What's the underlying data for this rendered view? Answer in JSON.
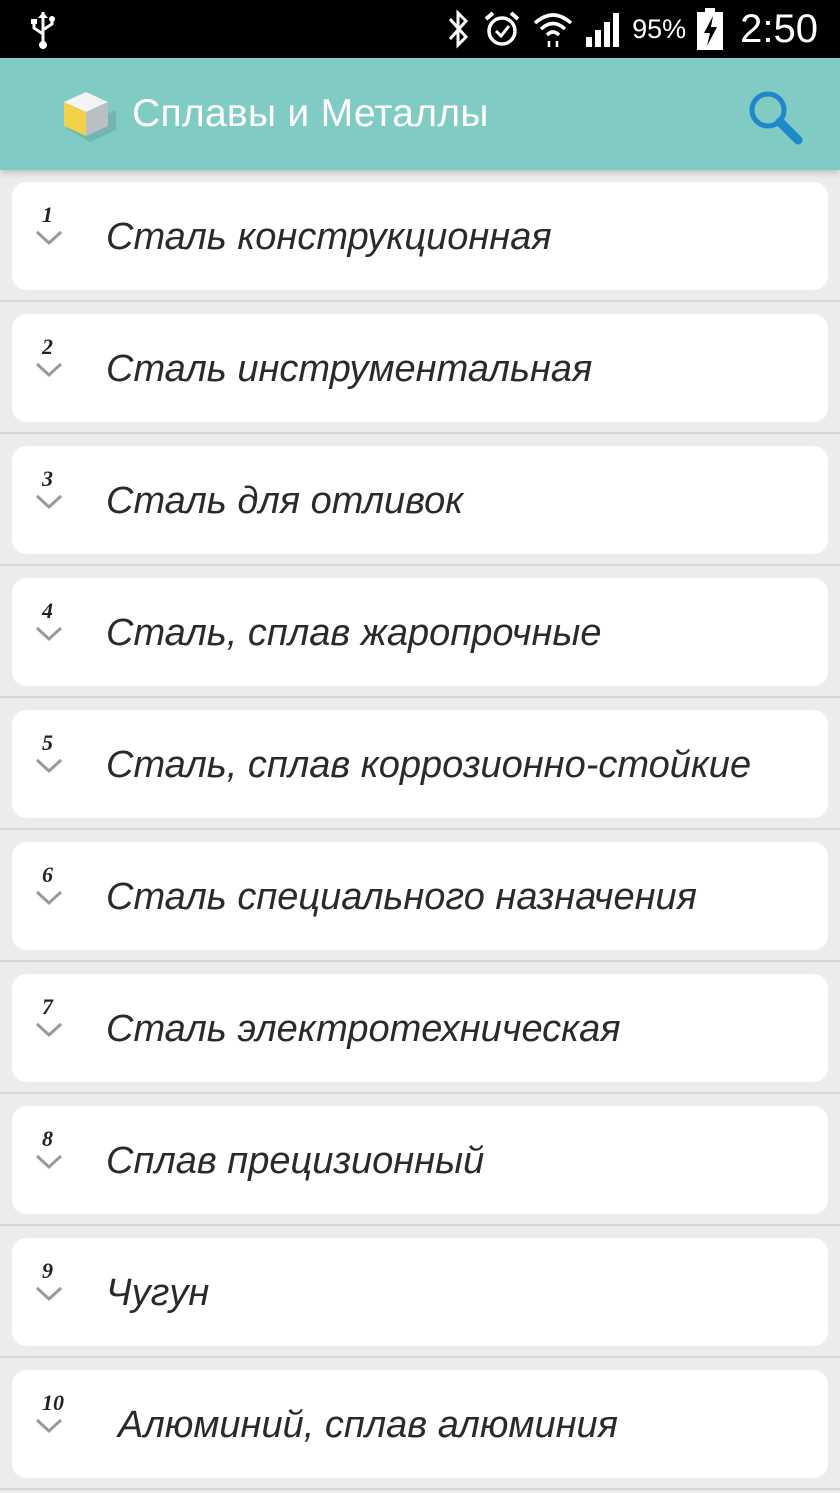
{
  "status_bar": {
    "battery_percent": "95%",
    "time": "2:50",
    "icons": [
      "usb-icon",
      "bluetooth-icon",
      "alarm-icon",
      "wifi-icon",
      "signal-icon",
      "battery-charging-icon"
    ]
  },
  "app_bar": {
    "title": "Сплавы и Металлы",
    "icon": "cube-app-icon",
    "search_icon": "search-icon",
    "background_color": "#80cbc4"
  },
  "list": {
    "items": [
      {
        "number": "1",
        "label": "Сталь конструкционная"
      },
      {
        "number": "2",
        "label": "Сталь инструментальная"
      },
      {
        "number": "3",
        "label": "Сталь для отливок"
      },
      {
        "number": "4",
        "label": "Сталь, сплав жаропрочные"
      },
      {
        "number": "5",
        "label": "Сталь, сплав коррозионно-стойкие"
      },
      {
        "number": "6",
        "label": "Сталь специального назначения"
      },
      {
        "number": "7",
        "label": "Сталь электротехническая"
      },
      {
        "number": "8",
        "label": "Сплав прецизионный"
      },
      {
        "number": "9",
        "label": "Чугун"
      },
      {
        "number": "10",
        "label": "Алюминий, сплав алюминия"
      }
    ]
  }
}
